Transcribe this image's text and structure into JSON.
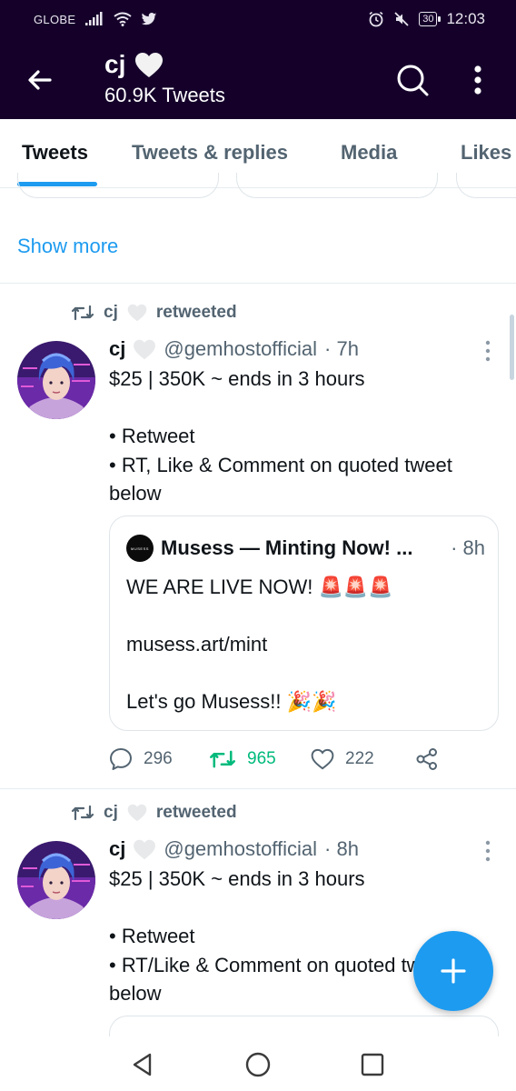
{
  "status_bar": {
    "carrier": "GLOBE",
    "battery": "30",
    "time": "12:03"
  },
  "header": {
    "name": "cj",
    "tweet_count": "60.9K Tweets"
  },
  "tabs": [
    {
      "label": "Tweets",
      "active": true
    },
    {
      "label": "Tweets & replies",
      "active": false
    },
    {
      "label": "Media",
      "active": false
    },
    {
      "label": "Likes",
      "active": false
    }
  ],
  "show_more": "Show more",
  "tweets": [
    {
      "retweeted_by": "cj",
      "retweeted_label": "retweeted",
      "name": "cj",
      "handle": "@gemhostofficial",
      "time": "· 7h",
      "lines": [
        "$25 | 350K ~ ends in 3 hours",
        "",
        "• Retweet",
        "• RT, Like & Comment on quoted tweet below"
      ],
      "quote": {
        "logo_text": "MUSESS",
        "name": "Musess — Minting Now! ...",
        "time": "· 8h",
        "lines": [
          "WE ARE LIVE NOW! 🚨🚨🚨",
          "",
          "musess.art/mint",
          "",
          "Let's go Musess!! 🎉🎉"
        ]
      },
      "replies": "296",
      "retweets": "965",
      "likes": "222"
    },
    {
      "retweeted_by": "cj",
      "retweeted_label": "retweeted",
      "name": "cj",
      "handle": "@gemhostofficial",
      "time": "· 8h",
      "lines": [
        "$25 | 350K ~ ends in 3 hours",
        "",
        "• Retweet",
        "• RT/Like & Comment on quoted tweet below"
      ]
    }
  ],
  "colors": {
    "header_bg": "#15002a",
    "accent": "#1d9bf0",
    "retweet_green": "#00ba7c",
    "secondary_text": "#536471"
  },
  "icons": {
    "back": "arrow-left-icon",
    "search": "search-icon",
    "more": "more-vertical-icon",
    "retweet": "retweet-icon",
    "heart": "heart-icon",
    "reply": "reply-icon",
    "share": "share-icon",
    "compose": "plus-icon"
  }
}
